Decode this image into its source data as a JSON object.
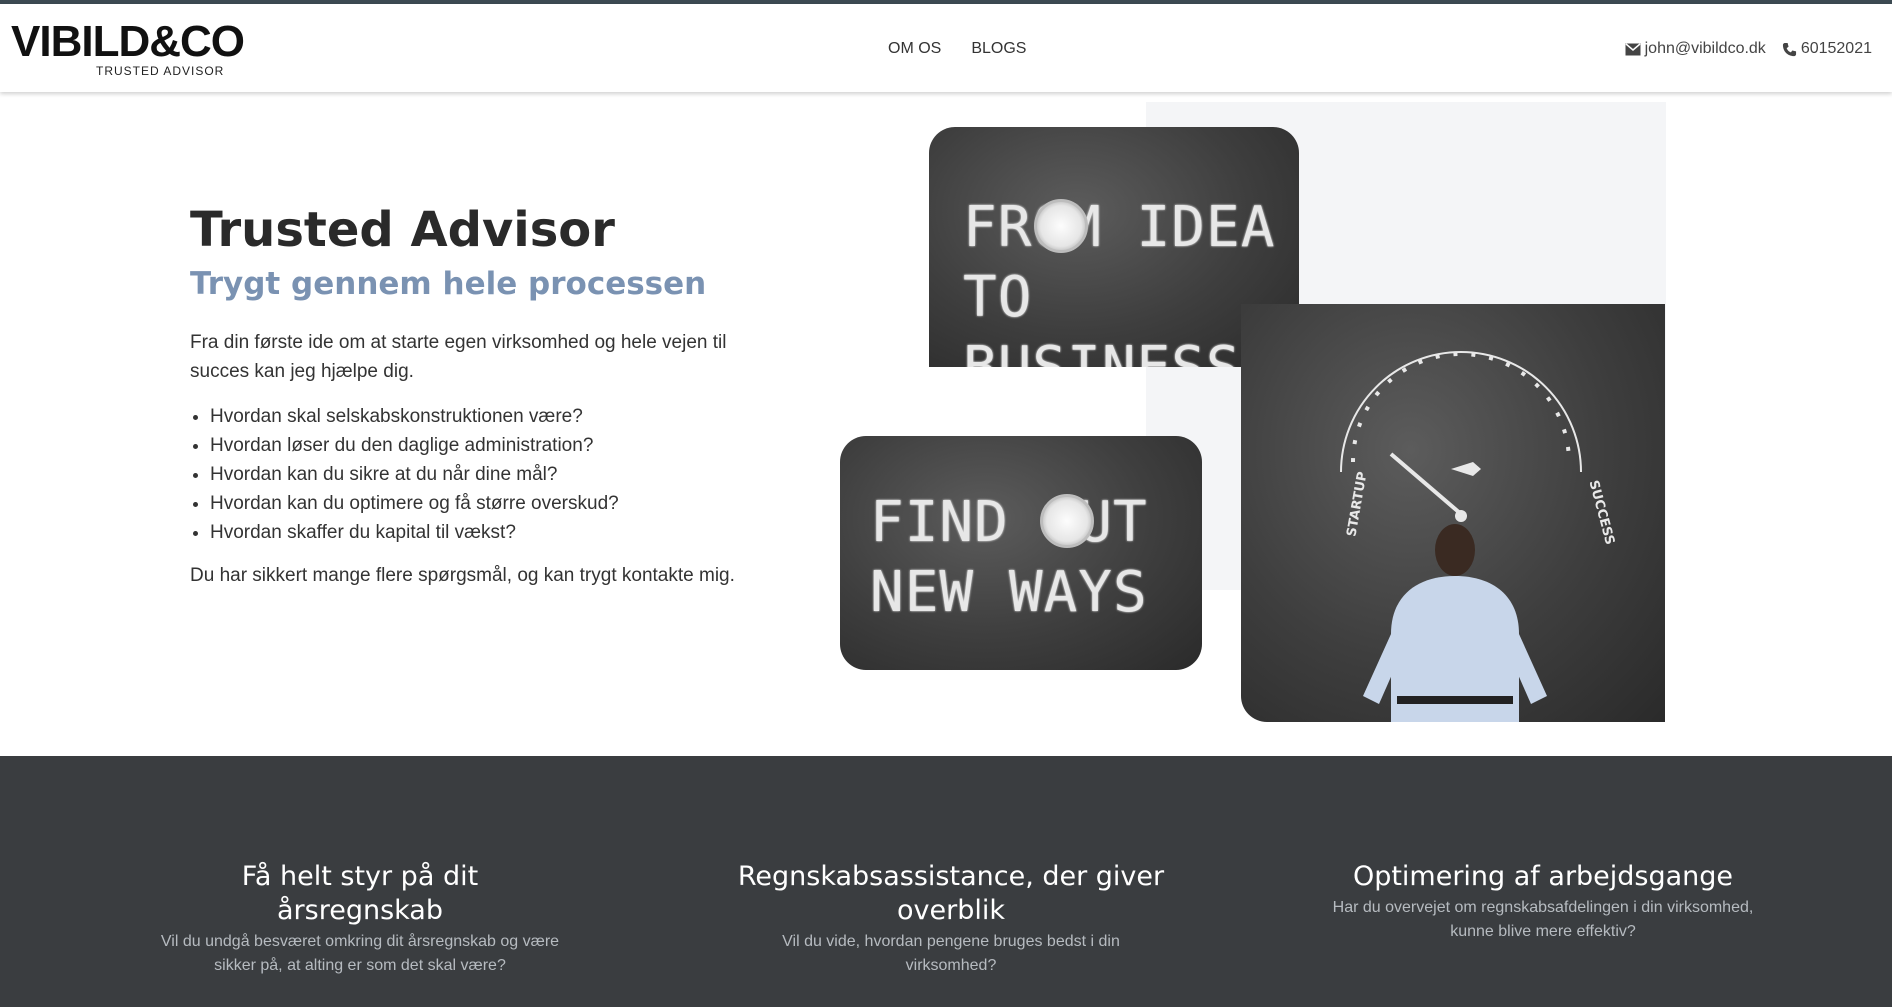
{
  "header": {
    "logo": {
      "main": "VIBILD&CO",
      "sub": "TRUSTED ADVISOR"
    },
    "nav": [
      {
        "label": "OM OS"
      },
      {
        "label": "BLOGS"
      }
    ],
    "contact": {
      "email": "john@vibildco.dk",
      "phone": "60152021"
    }
  },
  "hero": {
    "title": "Trusted Advisor",
    "subtitle": "Trygt gennem hele processen",
    "intro": "Fra din første ide om at starte egen virksomhed og hele vejen til succes kan jeg hjælpe dig.",
    "questions": [
      "Hvordan skal selskabskonstruktionen være?",
      "Hvordan løser du den daglige administration?",
      "Hvordan kan du sikre at du når dine mål?",
      "Hvordan kan du optimere og få større overskud?",
      "Hvordan skaffer du kapital til vækst?"
    ],
    "outro": "Du har sikkert mange flere spørgsmål, og kan trygt kontakte mig."
  },
  "images": {
    "img1_text": [
      "FROM IDEA",
      "TO BUSINESS"
    ],
    "img2_text": [
      "FIND OUT",
      "NEW WAYS"
    ],
    "img3_labels": {
      "left": "STARTUP",
      "right": "SUCCESS"
    }
  },
  "features": [
    {
      "title": "Få helt styr på dit årsregnskab",
      "text": "Vil du undgå besværet omkring dit årsregnskab og være sikker på, at alting er som det skal være?"
    },
    {
      "title": "Regnskabsassistance, der giver overblik",
      "text": "Vil du vide, hvordan pengene bruges bedst i din virksomhed?"
    },
    {
      "title": "Optimering af arbejdsgange",
      "text": "Har du overvejet om regnskabsafdelingen i din virksomhed, kunne blive mere effektiv?"
    }
  ],
  "colors": {
    "accent": "#7a92b2",
    "footer_bg": "#3a3d40",
    "top_bar": "#3c4a52"
  }
}
